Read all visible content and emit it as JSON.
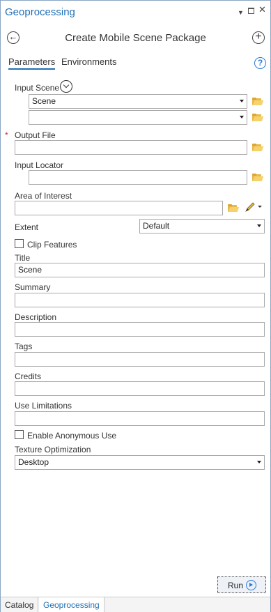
{
  "pane": {
    "title": "Geoprocessing"
  },
  "tool": {
    "title": "Create Mobile Scene Package"
  },
  "tabs": {
    "parameters": "Parameters",
    "environments": "Environments"
  },
  "help": {
    "glyph": "?"
  },
  "form": {
    "input_scene": {
      "label": "Input Scene",
      "rows": [
        {
          "value": "Scene"
        },
        {
          "value": ""
        }
      ]
    },
    "output_file": {
      "label": "Output File",
      "required_marker": "*",
      "value": ""
    },
    "input_locator": {
      "label": "Input Locator",
      "value": ""
    },
    "area_of_interest": {
      "label": "Area of Interest",
      "value": ""
    },
    "extent": {
      "label": "Extent",
      "value": "Default"
    },
    "clip_features": {
      "label": "Clip Features",
      "checked": false
    },
    "title": {
      "label": "Title",
      "value": "Scene"
    },
    "summary": {
      "label": "Summary",
      "value": ""
    },
    "description": {
      "label": "Description",
      "value": ""
    },
    "tags": {
      "label": "Tags",
      "value": ""
    },
    "credits": {
      "label": "Credits",
      "value": ""
    },
    "use_limitations": {
      "label": "Use Limitations",
      "value": ""
    },
    "enable_anonymous_use": {
      "label": "Enable Anonymous Use",
      "checked": false
    },
    "texture_optimization": {
      "label": "Texture Optimization",
      "value": "Desktop"
    }
  },
  "run": {
    "label": "Run"
  },
  "bottom_tabs": {
    "catalog": "Catalog",
    "geoprocessing": "Geoprocessing"
  },
  "colors": {
    "accent": "#1f6fb5",
    "required": "#d03030",
    "folder": "#e8b84a"
  }
}
